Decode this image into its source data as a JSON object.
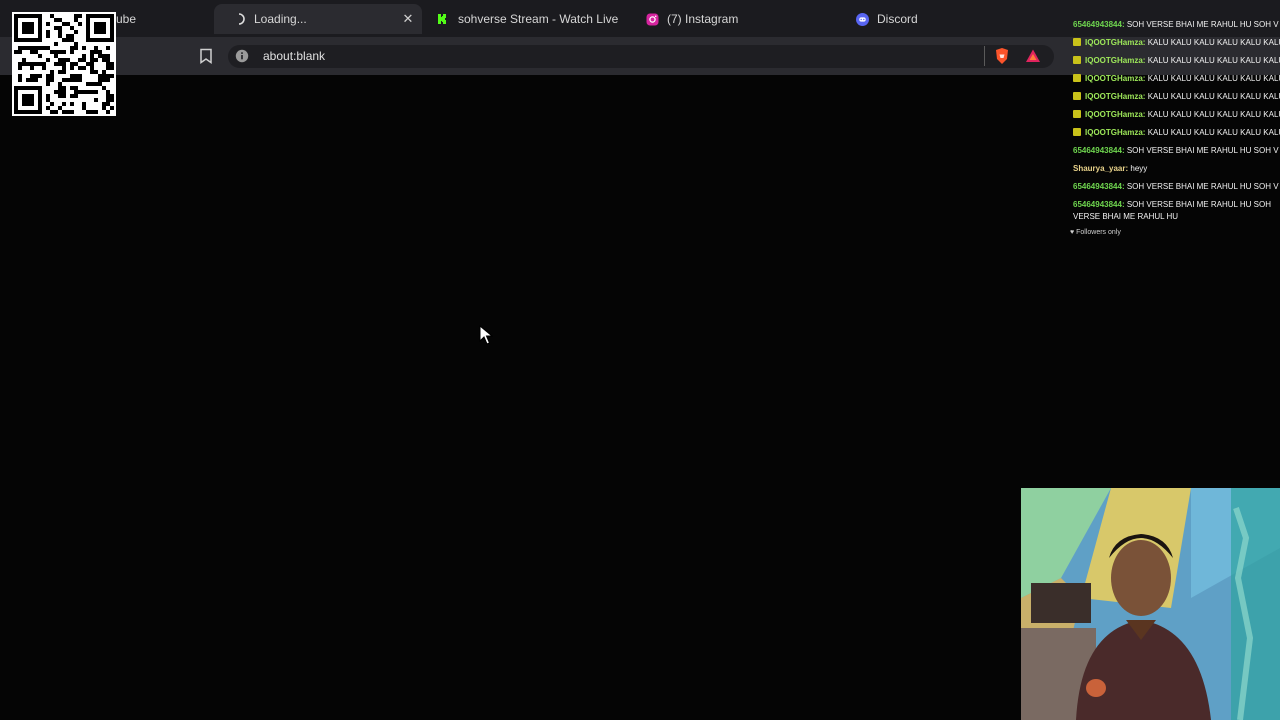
{
  "tabs": [
    {
      "title": "ube",
      "icon": "youtube-icon"
    },
    {
      "title": "Loading...",
      "icon": "loading-spinner-icon",
      "active": true,
      "close": "✕"
    },
    {
      "title": "sohverse Stream - Watch Live on",
      "icon": "kick-icon"
    },
    {
      "title": "(7) Instagram",
      "icon": "instagram-icon"
    },
    {
      "title": "Discord",
      "icon": "discord-icon"
    }
  ],
  "toolbar": {
    "url": "about:blank",
    "bookmark_icon": "bookmark-icon",
    "info_icon": "info-icon",
    "brave_icon": "brave-shield-icon",
    "rewards_icon": "brave-rewards-icon"
  },
  "chat": {
    "messages": [
      {
        "user": "65464943844:",
        "text": "SOH VERSE BHAI ME RAHUL HU SOH V",
        "color": "#6fd64f"
      },
      {
        "user": "IQOOTGHamza:",
        "text": "KALU KALU KALU KALU KALU KALU KALI",
        "color": "#9ee85a",
        "badge": true
      },
      {
        "user": "IQOOTGHamza:",
        "text": "KALU KALU KALU KALU KALU KALU KALI",
        "color": "#9ee85a",
        "badge": true
      },
      {
        "user": "IQOOTGHamza:",
        "text": "KALU KALU KALU KALU KALU KALU KALI",
        "color": "#9ee85a",
        "badge": true
      },
      {
        "user": "IQOOTGHamza:",
        "text": "KALU KALU KALU KALU KALU KALU KALI",
        "color": "#9ee85a",
        "badge": true
      },
      {
        "user": "IQOOTGHamza:",
        "text": "KALU KALU KALU KALU KALU KALU KALI",
        "color": "#9ee85a",
        "badge": true
      },
      {
        "user": "IQOOTGHamza:",
        "text": "KALU KALU KALU KALU KALU KALU KALI",
        "color": "#9ee85a",
        "badge": true
      },
      {
        "user": "65464943844:",
        "text": "SOH VERSE BHAI ME RAHUL HU SOH V",
        "color": "#6fd64f"
      },
      {
        "user": "Shaurya_yaar:",
        "text": "heyy",
        "color": "#e8d28a"
      },
      {
        "user": "65464943844:",
        "text": "SOH VERSE BHAI ME RAHUL HU SOH V",
        "color": "#6fd64f"
      },
      {
        "user": "65464943844:",
        "text": "SOH VERSE BHAI ME RAHUL HU SOH VERSE BHAI ME RAHUL HU",
        "color": "#6fd64f",
        "wrap": true
      }
    ],
    "followers_only": "Followers only"
  },
  "colors": {
    "background": "#050505",
    "tabbar": "#1b1b1f",
    "toolbar": "#2b2b30",
    "kick_green": "#53fc18",
    "discord": "#5865f2",
    "brave_orange": "#fb542b"
  }
}
